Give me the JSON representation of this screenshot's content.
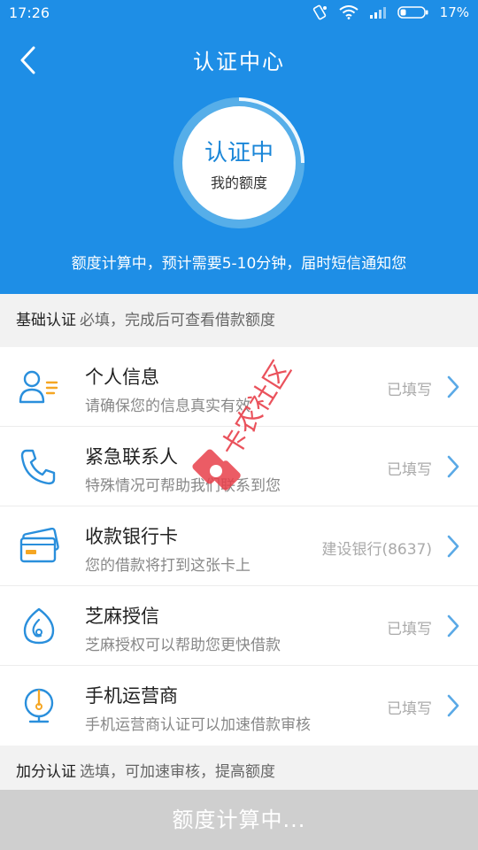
{
  "status": {
    "time": "17:26",
    "battery": "17%"
  },
  "header": {
    "title": "认证中心",
    "ring_main": "认证中",
    "ring_sub": "我的额度",
    "notice": "额度计算中，预计需要5-10分钟，届时短信通知您"
  },
  "sections": {
    "basic_title": "基础认证",
    "basic_desc": "必填，完成后可查看借款额度",
    "bonus_title": "加分认证",
    "bonus_desc": "选填，可加速审核，提高额度"
  },
  "items": [
    {
      "title": "个人信息",
      "sub": "请确保您的信息真实有效",
      "status": "已填写",
      "icon": "person-icon"
    },
    {
      "title": "紧急联系人",
      "sub": "特殊情况可帮助我们联系到您",
      "status": "已填写",
      "icon": "phone-icon"
    },
    {
      "title": "收款银行卡",
      "sub": "您的借款将打到这张卡上",
      "status": "建设银行(8637)",
      "icon": "bank-card-icon"
    },
    {
      "title": "芝麻授信",
      "sub": "芝麻授权可以帮助您更快借款",
      "status": "已填写",
      "icon": "sesame-icon"
    },
    {
      "title": "手机运营商",
      "sub": "手机运营商认证可以加速借款审核",
      "status": "已填写",
      "icon": "globe-icon"
    }
  ],
  "bottom_button": "额度计算中...",
  "watermark": "卡农社区",
  "colors": {
    "primary": "#1e8ee6",
    "icon_blue": "#2a8fdc",
    "card_orange": "#f5a623"
  }
}
